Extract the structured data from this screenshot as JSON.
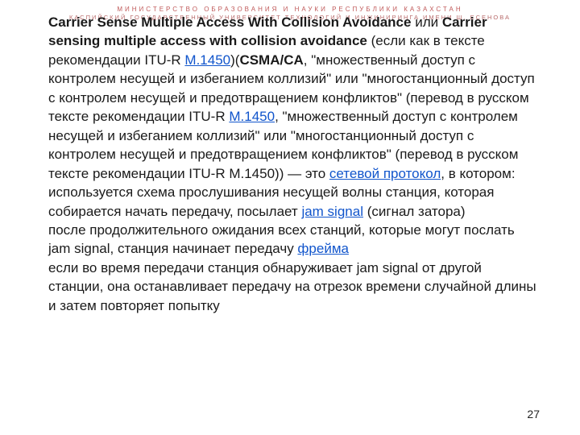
{
  "header": {
    "line1": "МИНИСТЕРСТВО ОБРАЗОВАНИЯ И НАУКИ РЕСПУБЛИКИ КАЗАХСТАН",
    "line2": "КАСПИЙСКИЙ ГОСУДАРСТВЕННЫЙ УНИВЕРСИТЕТ ТЕХНОЛОГИЙ И ИНЖИНИРИНГА ИМЕНИ Ш. ЕСЕНОВА"
  },
  "body": {
    "b1": "Carrier Sense Multiple Access With Collision Avoidance",
    "t1": " или ",
    "b2": "Carrier sensing multiple access with collision avoidance",
    "t2": " (если как в тексте рекомендации ITU-R ",
    "l1": "M.1450",
    "t3": ")(",
    "b3": "CSMA/CA",
    "t4": ", \"множественный доступ с контролем несущей и избеганием коллизий\" или \"многостанционный доступ с контролем несущей и предотвращением конфликтов\" (перевод в русском тексте рекомендации ITU-R ",
    "l2": "M.1450",
    "t5": ", \"множественный доступ с контролем несущей и избеганием коллизий\" или \"многостанционный доступ с контролем несущей и предотвращением конфликтов\" (перевод в русском тексте рекомендации ITU-R M.1450)) — это ",
    "l3": "сетевой протокол",
    "t6": ", в котором:",
    "p2a": "используется схема прослушивания несущей волны станция, которая собирается начать передачу, посылает ",
    "l4": "jam signal",
    "p2b": " (сигнал затора)",
    "p3a": "после продолжительного ожидания всех станций, которые могут послать jam signal, станция начинает передачу ",
    "l5": "фрейма",
    "p4": "если во время передачи станция обнаруживает jam signal от другой станции, она останавливает передачу на отрезок времени случайной длины и затем повторяет попытку"
  },
  "pagenum": "27"
}
